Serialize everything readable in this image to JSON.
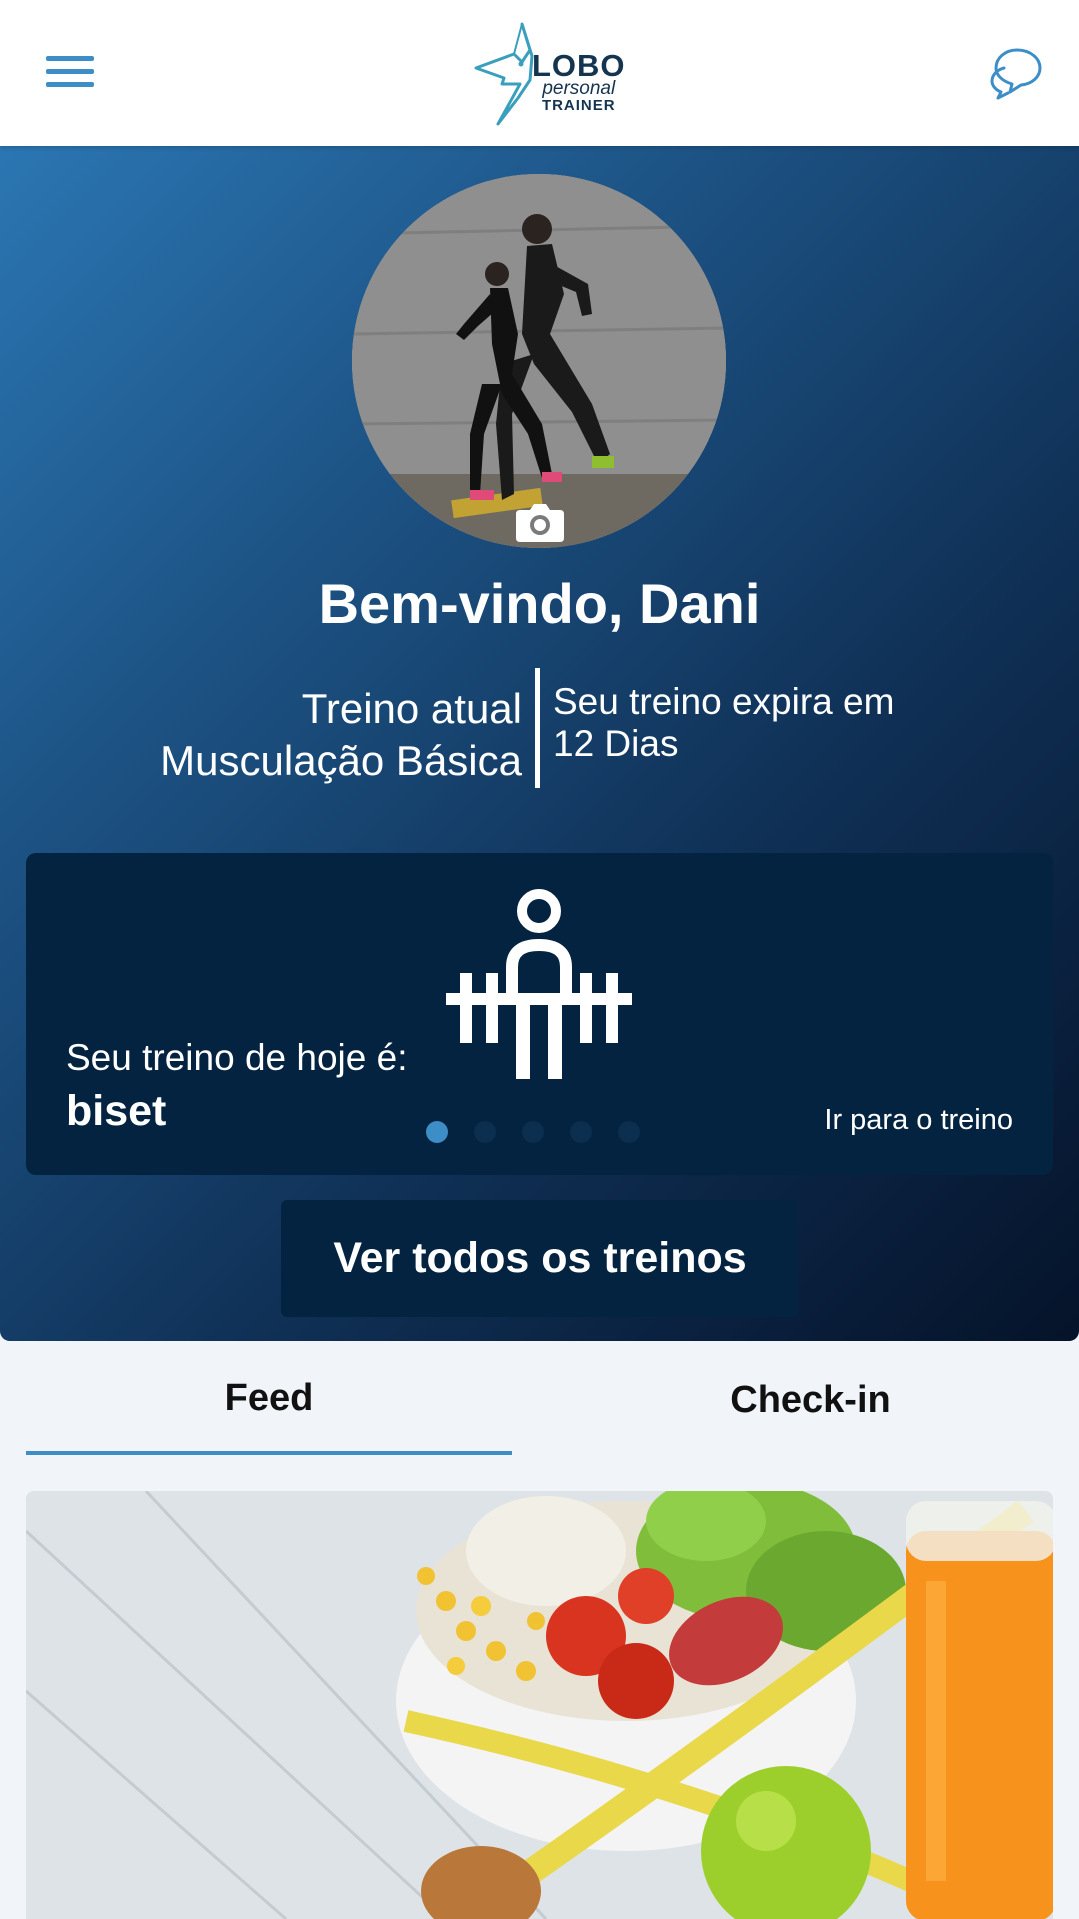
{
  "header": {
    "logo": {
      "line1": "LOBO",
      "line2": "personal",
      "line3": "TRAINER"
    },
    "menu_icon": "menu-hamburger-icon",
    "chat_icon": "chat-bubbles-icon"
  },
  "profile": {
    "welcome": "Bem-vindo, Dani",
    "camera_icon": "camera-icon"
  },
  "plan": {
    "current_label": "Treino atual",
    "current_name": "Musculação Básica",
    "expires_label": "Seu treino expira em",
    "expires_value": "12 Dias"
  },
  "today": {
    "label": "Seu treino de hoje é:",
    "name": "biset",
    "icon": "weightlifter-icon",
    "go_link": "Ir para o treino",
    "pagination": {
      "total": 5,
      "active": 1
    }
  },
  "actions": {
    "view_all": "Ver todos os treinos"
  },
  "tabs": [
    {
      "label": "Feed",
      "active": true
    },
    {
      "label": "Check-in",
      "active": false
    }
  ],
  "colors": {
    "accent": "#3d8ec7",
    "card_dark": "#032340",
    "hero_start": "#2b76b3",
    "hero_end": "#05132a"
  }
}
